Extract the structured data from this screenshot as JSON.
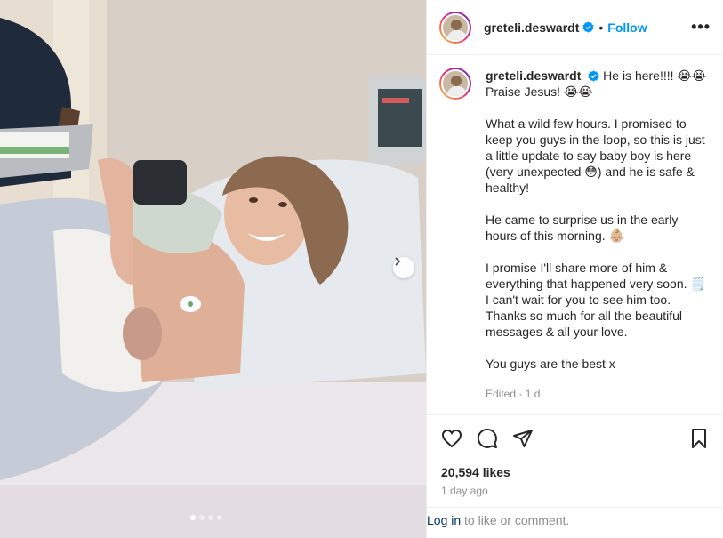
{
  "post": {
    "username": "greteli.deswardt",
    "separator": "•",
    "follow_label": "Follow",
    "more_label": "•••",
    "caption": {
      "line1": "He is here!!!! 😭😭 Praise Jesus! 😭😭",
      "para1": "What a wild few hours. I promised to keep you guys in the loop, so this is just a little update to say baby boy is here (very unexpected 😳) and he is safe & healthy!",
      "para2": "He came to surprise us in the early hours of this morning. 👶🏼",
      "para3": "I promise I'll share more of him & everything that happened very soon. 🗒️ I can't wait for you to see him too. Thanks so much for all the beautiful messages & all your love.",
      "para4": "You guys are the best x",
      "edited": "Edited · 1 d"
    },
    "likes": "20,594 likes",
    "posted_ago": "1 day ago",
    "login_link": "Log in",
    "login_suffix": " to like or comment."
  },
  "carousel": {
    "slides": 4,
    "active_index": 0
  },
  "colors": {
    "link_blue": "#0095f6",
    "verified_blue": "#0095f6",
    "muted": "#8e8e8e",
    "border": "#efefef"
  },
  "icons": [
    "heart-icon",
    "comment-icon",
    "share-icon",
    "bookmark-icon",
    "verified-badge-icon",
    "chevron-right-icon"
  ]
}
